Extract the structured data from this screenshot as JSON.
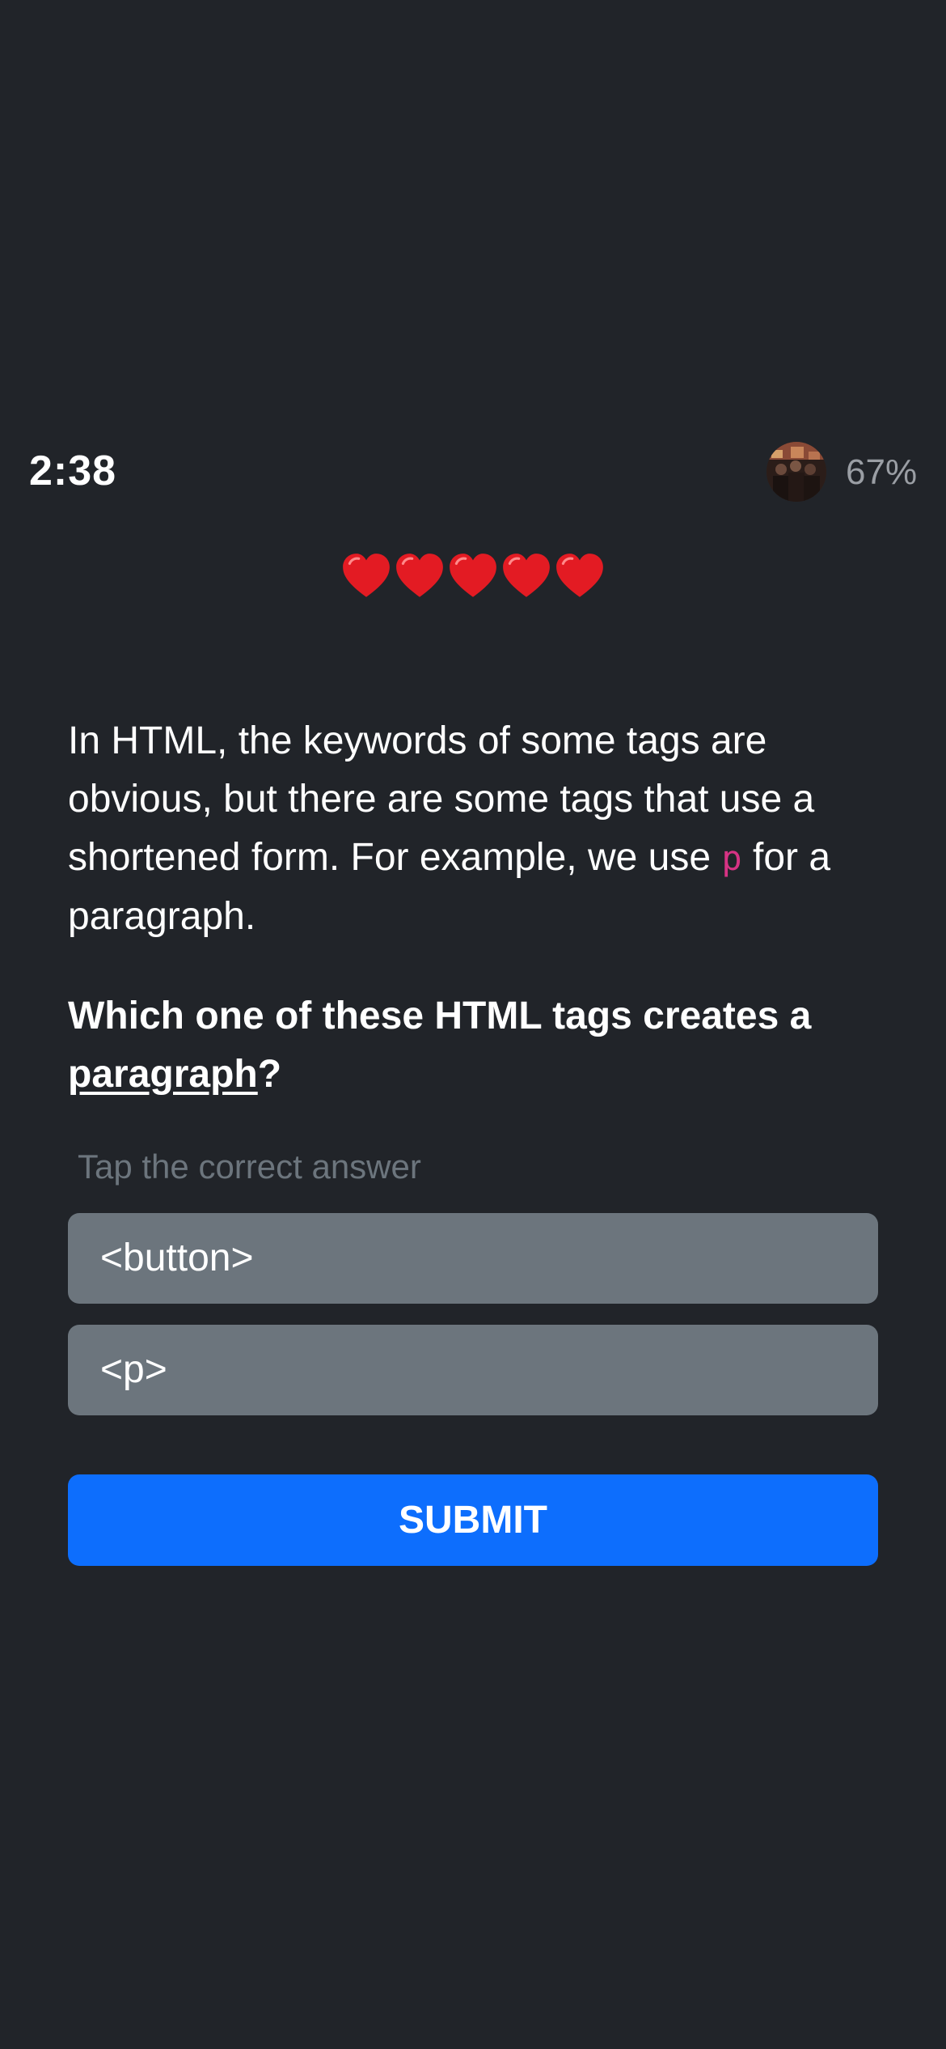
{
  "status": {
    "time": "2:38",
    "progress_text": "67%",
    "avatar_icon": "profile-avatar"
  },
  "lives": {
    "count": 5,
    "icon": "heart-icon",
    "color": "#e31b23"
  },
  "lesson": {
    "intro_part1": "In HTML, the keywords of some tags are obvious, but there are some tags that use a shortened form. For example, we use ",
    "intro_code": "p",
    "intro_part2": " for a paragraph.",
    "question_part1": "Which one of these HTML tags creates a ",
    "question_emphasis": "paragraph",
    "question_part2": "?",
    "hint": "Tap the correct answer"
  },
  "options": [
    {
      "label": "<button>"
    },
    {
      "label": "<p>"
    }
  ],
  "submit_label": "SUBMIT",
  "colors": {
    "background": "#212429",
    "option_bg": "#6c757d",
    "submit_bg": "#0d6efd",
    "code_color": "#d63384",
    "hint_color": "#6c757d"
  }
}
